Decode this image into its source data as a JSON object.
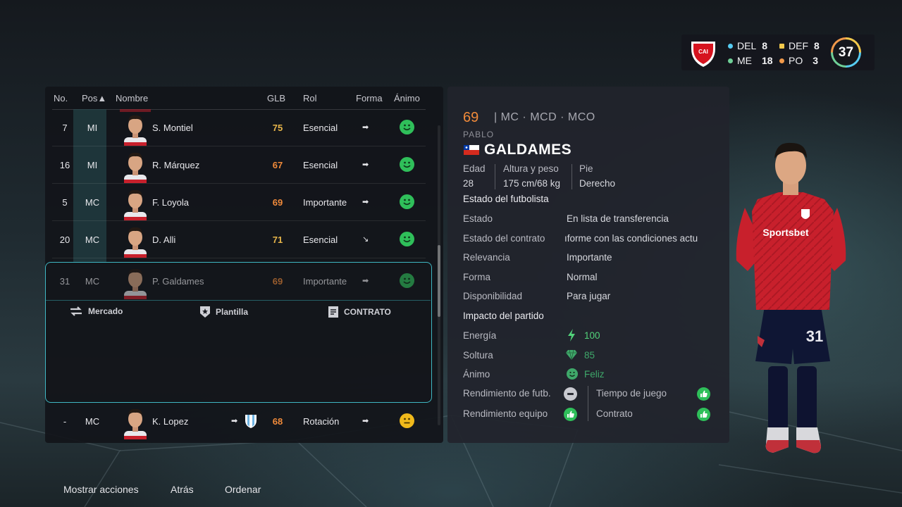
{
  "club": {
    "counts": [
      {
        "label": "DEL",
        "value": "8",
        "color": "#56ccf2"
      },
      {
        "label": "DEF",
        "value": "8",
        "color": "#f2c94c"
      },
      {
        "label": "ME",
        "value": "18",
        "color": "#6fcf97"
      },
      {
        "label": "PO",
        "value": "3",
        "color": "#f2994a"
      }
    ],
    "overall": "37",
    "crest_icon": "independiente-crest-icon"
  },
  "squad": {
    "headers": {
      "no": "No.",
      "pos": "Pos▲",
      "name": "Nombre",
      "glb": "GLB",
      "rol": "Rol",
      "forma": "Forma",
      "animo": "Ánimo"
    },
    "rows": [
      {
        "no": "7",
        "pos": "MI",
        "name": "S. Montiel",
        "glb": "75",
        "glb_color": "#e8b64a",
        "rol": "Esencial",
        "forma": "➡",
        "mood": "happy"
      },
      {
        "no": "16",
        "pos": "MI",
        "name": "R. Márquez",
        "glb": "67",
        "glb_color": "#f08a3a",
        "rol": "Esencial",
        "forma": "➡",
        "mood": "happy"
      },
      {
        "no": "5",
        "pos": "MC",
        "name": "F. Loyola",
        "glb": "69",
        "glb_color": "#f08a3a",
        "rol": "Importante",
        "forma": "➡",
        "mood": "happy"
      },
      {
        "no": "20",
        "pos": "MC",
        "name": "D. Alli",
        "glb": "71",
        "glb_color": "#e8b64a",
        "rol": "Esencial",
        "forma": "↘",
        "mood": "happy"
      },
      {
        "no": "31",
        "pos": "MC",
        "name": "P. Galdames",
        "glb": "69",
        "glb_color": "#f08a3a",
        "rol": "Importante",
        "forma": "➡",
        "mood": "happy"
      },
      {
        "no": "-",
        "pos": "MC",
        "name": "K. Lopez",
        "glb": "68",
        "glb_color": "#f08a3a",
        "rol": "Rotación",
        "forma": "➡",
        "mood": "neutral"
      }
    ],
    "actions": {
      "market": "Mercado",
      "squad": "Plantilla",
      "contract": "CONTRATO"
    }
  },
  "player": {
    "overall": "69",
    "positions": "| MC · MCD · MCO",
    "first_name": "PABLO",
    "last_name": "GALDAMES",
    "age_label": "Edad",
    "age": "28",
    "hw_label": "Altura y peso",
    "hw": "175 cm/68 kg",
    "foot_label": "Pie",
    "foot": "Derecho",
    "status_title": "Estado del futbolista",
    "status_rows": [
      {
        "label": "Estado",
        "value": "En lista de transferencia"
      },
      {
        "label": "Estado del contrato",
        "value": "ıforme con las condiciones actu"
      },
      {
        "label": "Relevancia",
        "value": "Importante"
      },
      {
        "label": "Forma",
        "value": "Normal"
      },
      {
        "label": "Disponibilidad",
        "value": "Para jugar"
      }
    ],
    "impact_title": "Impacto del partido",
    "energy_label": "Energía",
    "energy": "100",
    "soltura_label": "Soltura",
    "soltura": "85",
    "animo_label": "Ánimo",
    "animo": "Feliz",
    "perf_player_label": "Rendimiento de futb.",
    "perf_team_label": "Rendimiento equipo",
    "playtime_label": "Tiempo de juego",
    "contract_label": "Contrato",
    "shirt_number": "31",
    "sponsor": "Sportsbet"
  },
  "footer": {
    "actions": "Mostrar acciones",
    "back": "Atrás",
    "sort": "Ordenar"
  }
}
